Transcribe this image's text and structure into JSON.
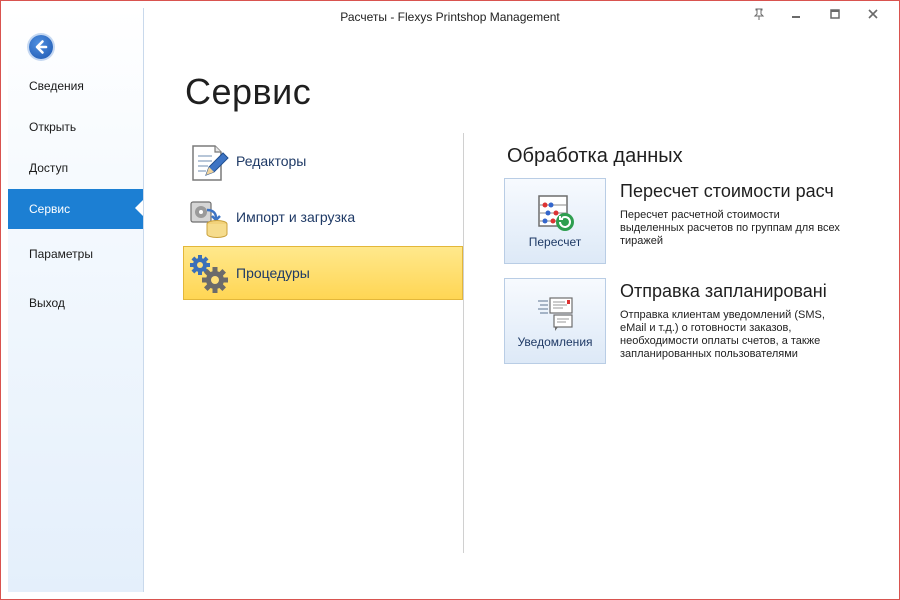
{
  "window": {
    "title": "Расчеты - Flexys Printshop Management",
    "controls": [
      "pin-icon",
      "minimize-icon",
      "restore-icon",
      "close-icon"
    ]
  },
  "sidebar": {
    "back_icon": "back-arrow-icon",
    "items": [
      {
        "label": "Сведения"
      },
      {
        "label": "Открыть"
      },
      {
        "label": "Доступ"
      },
      {
        "label": "Сервис",
        "active": true
      },
      {
        "label": "Параметры"
      },
      {
        "label": "Выход"
      }
    ]
  },
  "main": {
    "title": "Сервис",
    "categories": [
      {
        "label": "Редакторы",
        "icon": "document-pencil-icon"
      },
      {
        "label": "Импорт и загрузка",
        "icon": "import-database-icon"
      },
      {
        "label": "Процедуры",
        "icon": "gears-icon",
        "selected": true
      }
    ]
  },
  "panel": {
    "title": "Обработка данных",
    "actions": [
      {
        "button_label": "Пересчет",
        "icon": "abacus-refresh-icon",
        "title": "Пересчет стоимости расч",
        "description": "Пересчет расчетной стоимости выделенных расчетов по группам для всех тиражей"
      },
      {
        "button_label": "Уведомления",
        "icon": "notification-messages-icon",
        "title": "Отправка запланировані",
        "description": "Отправка клиентам уведомлений (SMS, eMail и т.д.) о готовности заказов, необходимости оплаты счетов, а также запланированных пользователями"
      }
    ]
  },
  "colors": {
    "accent": "#1c7fd3",
    "selection": "#ffd654",
    "frame_border": "#d9534f"
  }
}
